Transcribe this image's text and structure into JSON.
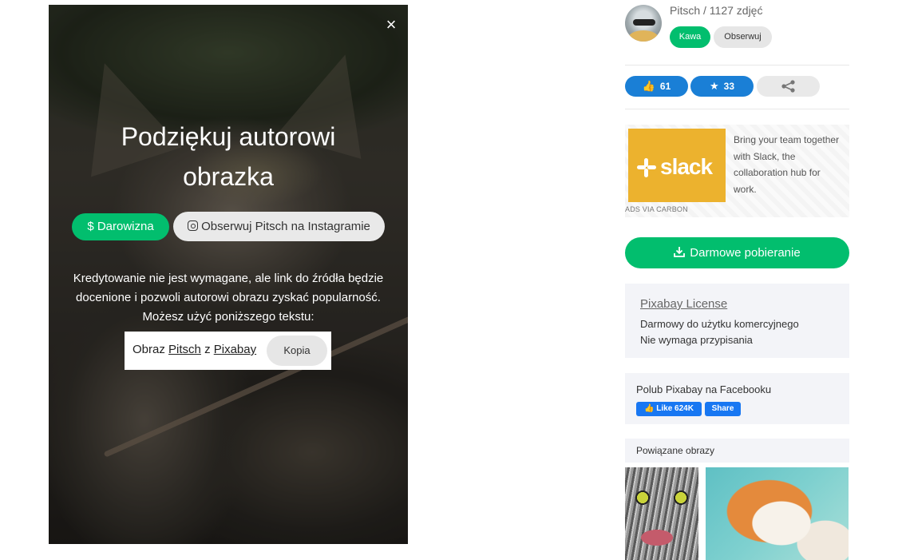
{
  "modal": {
    "close_symbol": "×",
    "title_line1": "Podziękuj autorowi",
    "title_line2": "obrazka",
    "donate_label": "$ Darowizna",
    "instagram_label": "Obserwuj Pitsch na Instagramie",
    "credit_text": "Kredytowanie nie jest wymagane, ale link do źródła będzie docenione i pozwoli autorowi obrazu zyskać popularność. Możesz użyć poniższego tekstu:",
    "attribution": {
      "prefix": "Obraz",
      "author_link": "Pitsch",
      "middle": "z",
      "site_link": "Pixabay"
    },
    "copy_label": "Kopia"
  },
  "author": {
    "line": "Pitsch / 1127 zdjęć",
    "coffee_label": "Kawa",
    "follow_label": "Obserwuj"
  },
  "stats": {
    "likes": "61",
    "favorites": "33",
    "like_icon": "thumbs-up-icon",
    "favorite_icon": "star-icon",
    "share_icon": "share-icon"
  },
  "ad": {
    "brand": "slack",
    "text": "Bring your team together with Slack, the collaboration hub for work.",
    "via": "ADS VIA CARBON"
  },
  "download": {
    "label": "Darmowe pobieranie",
    "icon": "download-icon"
  },
  "license": {
    "title": "Pixabay License",
    "line1": "Darmowy do użytku komercyjnego",
    "line2": "Nie wymaga przypisania"
  },
  "facebook": {
    "title": "Polub Pixabay na Facebooku",
    "like_label": "Like 624K",
    "share_label": "Share"
  },
  "related": {
    "title": "Powiązane obrazy"
  },
  "colors": {
    "green": "#02be6e",
    "blue": "#1a7fd6",
    "facebook": "#1877f2",
    "panel": "#f3f4f8"
  }
}
